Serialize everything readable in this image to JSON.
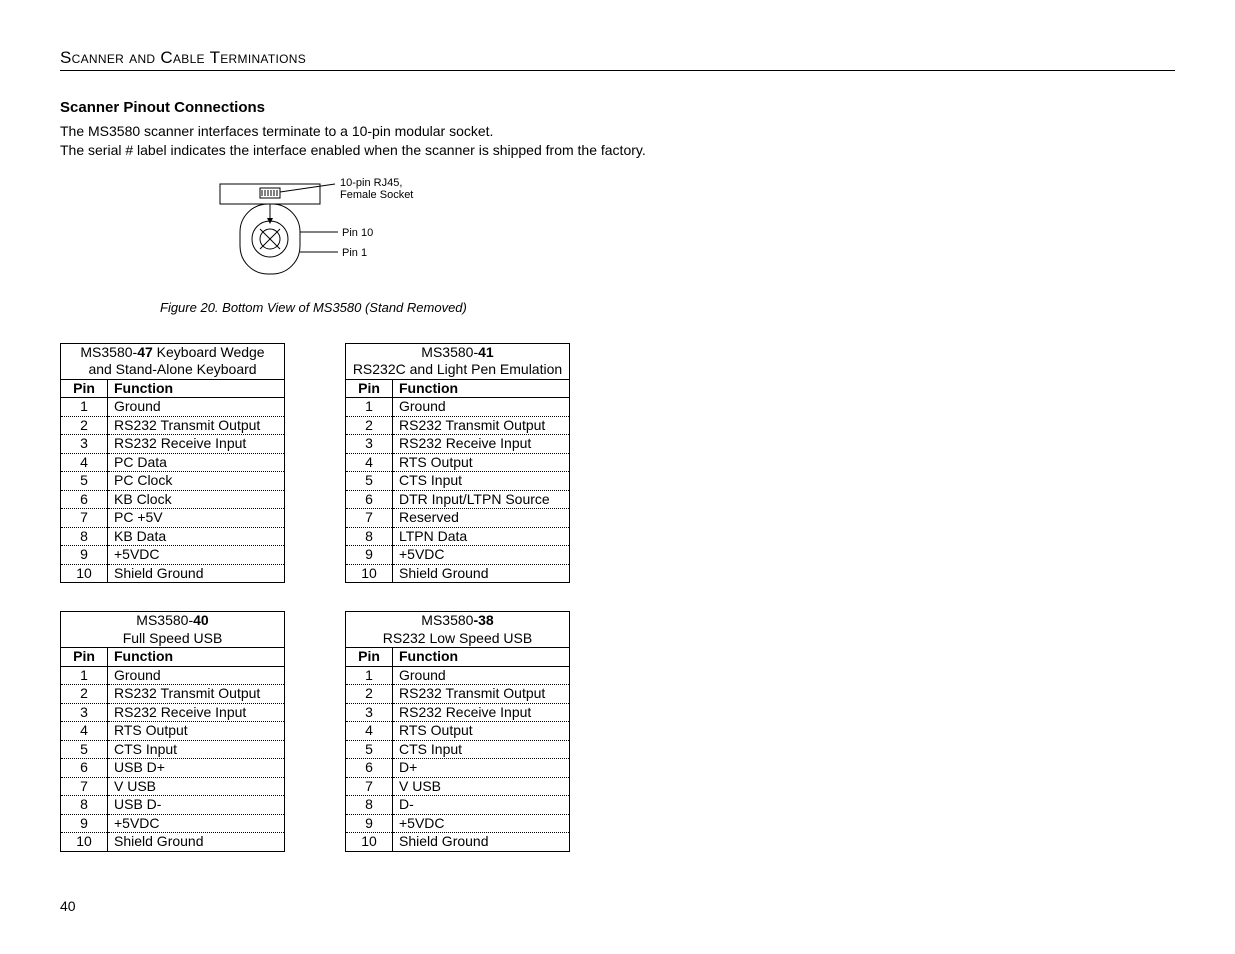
{
  "section_header": "Scanner and Cable Terminations",
  "sub_header": "Scanner Pinout Connections",
  "paragraph1": "The MS3580 scanner interfaces terminate to a 10-pin modular socket.",
  "paragraph2": "The serial # label indicates the interface enabled when the scanner is shipped from the factory.",
  "figure": {
    "caption": "Figure 20. Bottom View of MS3580 (Stand Removed)",
    "label_socket": "10-pin RJ45,",
    "label_socket2": "Female Socket",
    "label_pin10": "Pin 10",
    "label_pin1": "Pin 1"
  },
  "col_pin": "Pin",
  "col_func": "Function",
  "tables": [
    {
      "title_pre": "MS3580-",
      "title_bold": "47",
      "title_post": " Keyboard Wedge",
      "title_line2": "and Stand-Alone Keyboard",
      "rows": [
        [
          "1",
          "Ground"
        ],
        [
          "2",
          "RS232 Transmit Output"
        ],
        [
          "3",
          "RS232 Receive Input"
        ],
        [
          "4",
          "PC Data"
        ],
        [
          "5",
          "PC Clock"
        ],
        [
          "6",
          "KB Clock"
        ],
        [
          "7",
          "PC +5V"
        ],
        [
          "8",
          "KB Data"
        ],
        [
          "9",
          "+5VDC"
        ],
        [
          "10",
          "Shield Ground"
        ]
      ]
    },
    {
      "title_pre": "MS3580-",
      "title_bold": "41",
      "title_post": "",
      "title_line2": "RS232C and Light Pen Emulation",
      "rows": [
        [
          "1",
          "Ground"
        ],
        [
          "2",
          "RS232 Transmit Output"
        ],
        [
          "3",
          "RS232 Receive Input"
        ],
        [
          "4",
          "RTS Output"
        ],
        [
          "5",
          "CTS Input"
        ],
        [
          "6",
          "DTR Input/LTPN Source"
        ],
        [
          "7",
          "Reserved"
        ],
        [
          "8",
          "LTPN Data"
        ],
        [
          "9",
          "+5VDC"
        ],
        [
          "10",
          "Shield Ground"
        ]
      ]
    },
    {
      "title_pre": "MS3580-",
      "title_bold": "40",
      "title_post": "",
      "title_line2": "Full Speed USB",
      "rows": [
        [
          "1",
          "Ground"
        ],
        [
          "2",
          "RS232 Transmit Output"
        ],
        [
          "3",
          "RS232 Receive Input"
        ],
        [
          "4",
          "RTS Output"
        ],
        [
          "5",
          "CTS Input"
        ],
        [
          "6",
          "USB D+"
        ],
        [
          "7",
          "V USB"
        ],
        [
          "8",
          "USB D-"
        ],
        [
          "9",
          "+5VDC"
        ],
        [
          "10",
          "Shield Ground"
        ]
      ]
    },
    {
      "title_pre": "MS3580",
      "title_bold": "-38",
      "title_post": "",
      "title_line2": "RS232 Low Speed USB",
      "rows": [
        [
          "1",
          "Ground"
        ],
        [
          "2",
          "RS232 Transmit Output"
        ],
        [
          "3",
          "RS232 Receive Input"
        ],
        [
          "4",
          "RTS Output"
        ],
        [
          "5",
          "CTS Input"
        ],
        [
          "6",
          "D+"
        ],
        [
          "7",
          "V USB"
        ],
        [
          "8",
          "D-"
        ],
        [
          "9",
          "+5VDC"
        ],
        [
          "10",
          "Shield Ground"
        ]
      ]
    }
  ],
  "page_number": "40"
}
